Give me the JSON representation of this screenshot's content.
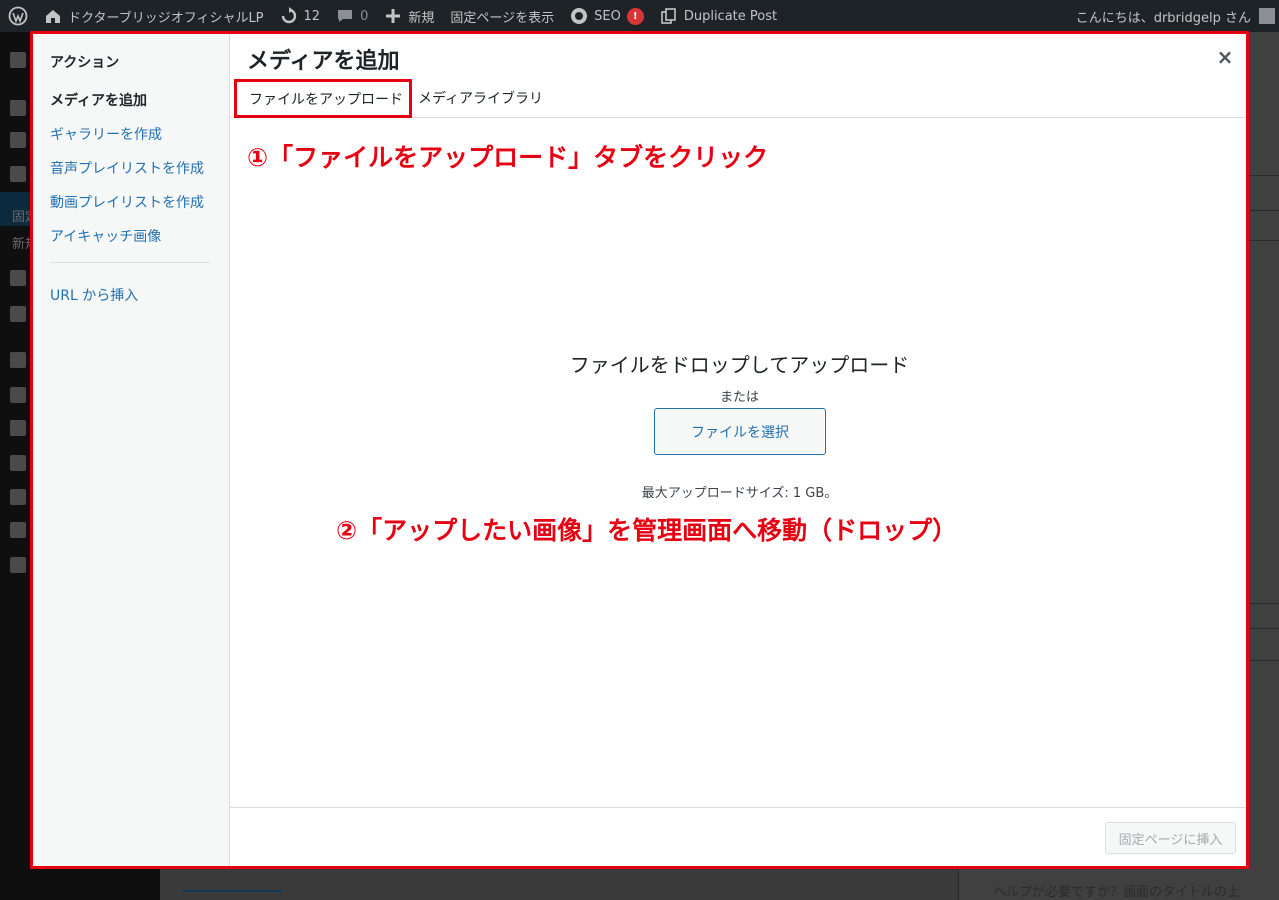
{
  "admin_bar": {
    "site_name": "ドクターブリッジオフィシャルLP",
    "updates_count": "12",
    "comments_count": "0",
    "new_label": "新規",
    "view_page_label": "固定ページを表示",
    "seo_label": "SEO",
    "seo_badge": "!",
    "duplicate_post_label": "Duplicate Post",
    "greeting": "こんにちは、drbridgelp さん"
  },
  "background": {
    "sidebar_sub_1": "固定",
    "sidebar_sub_2": "新規",
    "help_text": "ヘルプが必要ですか？画面のタイトルの上"
  },
  "modal": {
    "menu": {
      "title": "アクション",
      "items": [
        "メディアを追加",
        "ギャラリーを作成",
        "音声プレイリストを作成",
        "動画プレイリストを作成",
        "アイキャッチ画像",
        "URL から挿入"
      ]
    },
    "title": "メディアを追加",
    "close_symbol": "×",
    "tabs": {
      "upload": "ファイルをアップロード",
      "library": "メディアライブラリ"
    },
    "uploader": {
      "drop_text": "ファイルをドロップしてアップロード",
      "or_text": "または",
      "select_button": "ファイルを選択",
      "max_size": "最大アップロードサイズ: 1 GB。"
    },
    "insert_button": "固定ページに挿入"
  },
  "annotations": {
    "step1": "①「ファイルをアップロード」タブをクリック",
    "step2": "②「アップしたい画像」を管理画面へ移動（ドロップ）"
  },
  "colors": {
    "annotation_red": "#e60012",
    "link_blue": "#2271b1",
    "admin_bar": "#1d2327"
  }
}
